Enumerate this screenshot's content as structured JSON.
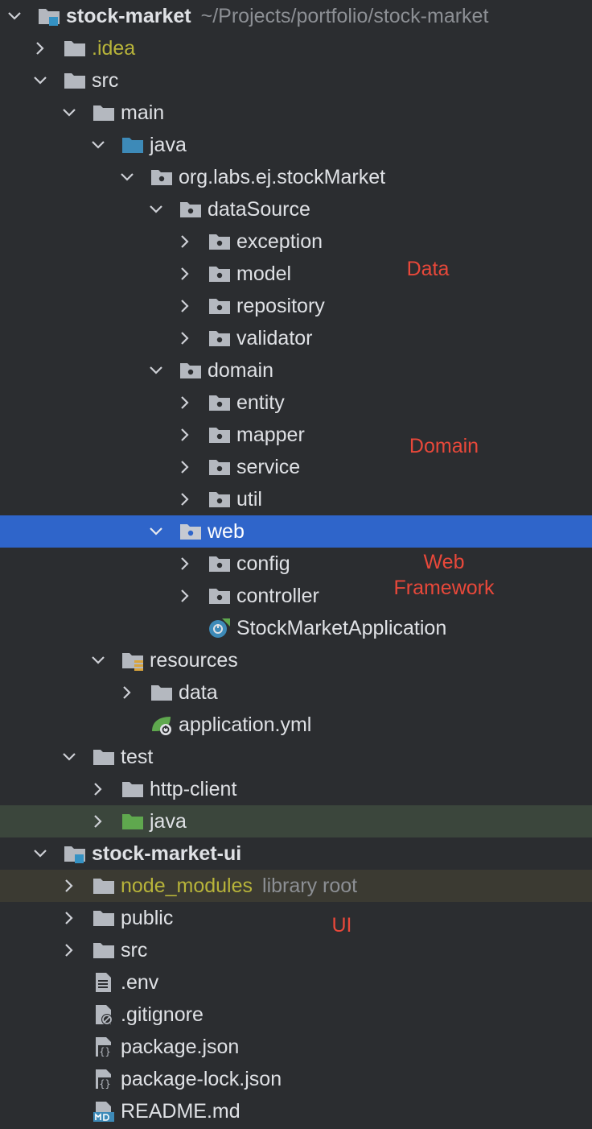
{
  "tree": {
    "rows": [
      {
        "label": "stock-market",
        "hint": "~/Projects/portfolio/stock-market",
        "icon": "module-folder-icon",
        "expanded": true
      },
      {
        "label": ".idea",
        "icon": "folder-icon",
        "expanded": false
      },
      {
        "label": "src",
        "icon": "folder-icon",
        "expanded": true
      },
      {
        "label": "main",
        "icon": "folder-icon",
        "expanded": true
      },
      {
        "label": "java",
        "icon": "source-root-folder-icon",
        "expanded": true
      },
      {
        "label": "org.labs.ej.stockMarket",
        "icon": "package-icon",
        "expanded": true
      },
      {
        "label": "dataSource",
        "icon": "package-icon",
        "expanded": true
      },
      {
        "label": "exception",
        "icon": "package-icon",
        "expanded": false
      },
      {
        "label": "model",
        "icon": "package-icon",
        "expanded": false
      },
      {
        "label": "repository",
        "icon": "package-icon",
        "expanded": false
      },
      {
        "label": "validator",
        "icon": "package-icon",
        "expanded": false
      },
      {
        "label": "domain",
        "icon": "package-icon",
        "expanded": true
      },
      {
        "label": "entity",
        "icon": "package-icon",
        "expanded": false
      },
      {
        "label": "mapper",
        "icon": "package-icon",
        "expanded": false
      },
      {
        "label": "service",
        "icon": "package-icon",
        "expanded": false
      },
      {
        "label": "util",
        "icon": "package-icon",
        "expanded": false
      },
      {
        "label": "web",
        "icon": "package-icon",
        "expanded": true,
        "selected": true
      },
      {
        "label": "config",
        "icon": "package-icon",
        "expanded": false
      },
      {
        "label": "controller",
        "icon": "package-icon",
        "expanded": false
      },
      {
        "label": "StockMarketApplication",
        "icon": "spring-boot-app-icon"
      },
      {
        "label": "resources",
        "icon": "resources-folder-icon",
        "expanded": true
      },
      {
        "label": "data",
        "icon": "folder-icon",
        "expanded": false
      },
      {
        "label": "application.yml",
        "icon": "spring-config-file-icon"
      },
      {
        "label": "test",
        "icon": "folder-icon",
        "expanded": true
      },
      {
        "label": "http-client",
        "icon": "folder-icon",
        "expanded": false
      },
      {
        "label": "java",
        "icon": "test-root-folder-icon",
        "expanded": false
      },
      {
        "label": "stock-market-ui",
        "icon": "module-folder-icon",
        "expanded": true
      },
      {
        "label": "node_modules",
        "hint": "library root",
        "icon": "folder-icon",
        "expanded": false
      },
      {
        "label": "public",
        "icon": "folder-icon",
        "expanded": false
      },
      {
        "label": "src",
        "icon": "folder-icon",
        "expanded": false
      },
      {
        "label": ".env",
        "icon": "text-file-icon"
      },
      {
        "label": ".gitignore",
        "icon": "ignore-file-icon"
      },
      {
        "label": "package.json",
        "icon": "json-file-icon"
      },
      {
        "label": "package-lock.json",
        "icon": "json-file-icon"
      },
      {
        "label": "README.md",
        "icon": "markdown-file-icon"
      }
    ]
  },
  "annotations": {
    "data": "Data",
    "domain": "Domain",
    "web_line1": "Web",
    "web_line2": "Framework",
    "ui": "UI"
  },
  "colors": {
    "background": "#2b2d30",
    "selection": "#2f65ca",
    "annotation": "#e8483a",
    "excluded_text": "#b8b43a",
    "hint_text": "#8c8f94",
    "source_root": "#3d8ab8",
    "test_root": "#5fa84e"
  }
}
